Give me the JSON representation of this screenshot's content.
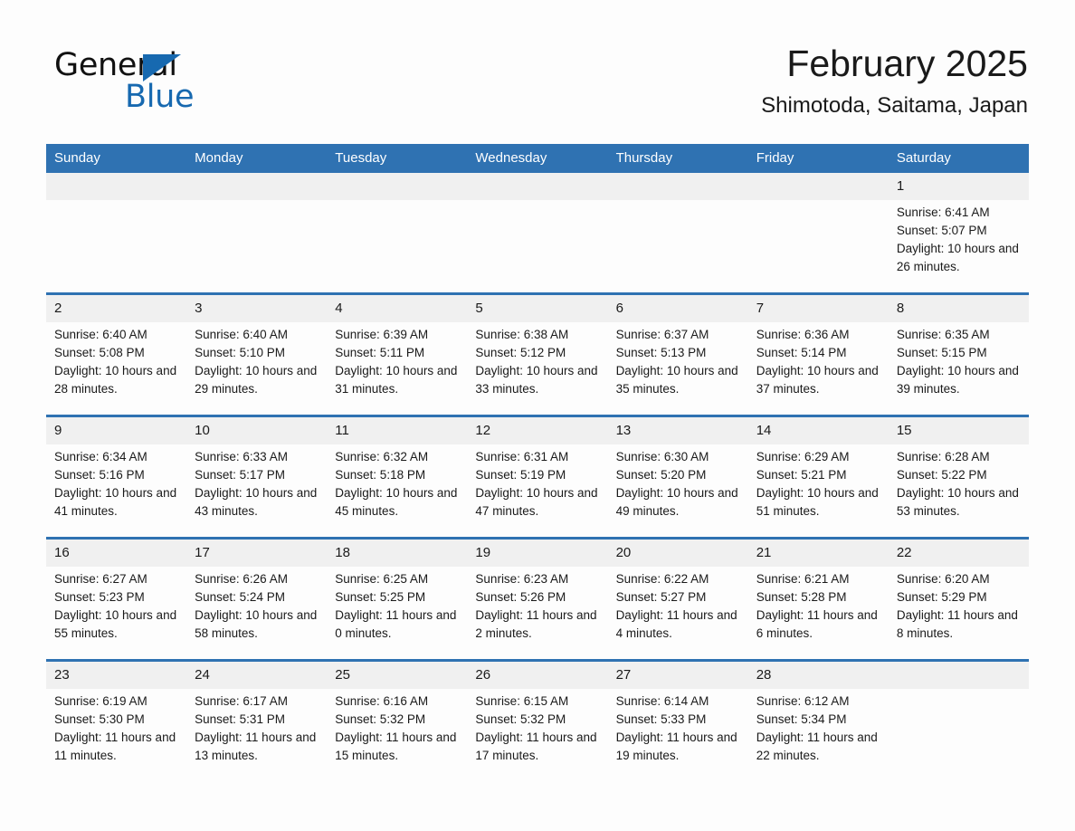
{
  "brand": {
    "name_top": "General",
    "name_bottom": "Blue",
    "triangle_color": "#1769b0",
    "text_color": "#111111"
  },
  "header": {
    "title": "February 2025",
    "subtitle": "Shimotoda, Saitama, Japan"
  },
  "theme": {
    "header_blue": "#2f72b2",
    "row_divider_blue": "#2f72b2",
    "daynum_band": "#f0f0f0",
    "page_bg": "#fdfdfd",
    "text": "#1a1a1a"
  },
  "calendar": {
    "weekday_headers": [
      "Sunday",
      "Monday",
      "Tuesday",
      "Wednesday",
      "Thursday",
      "Friday",
      "Saturday"
    ],
    "labels": {
      "sunrise": "Sunrise:",
      "sunset": "Sunset:",
      "daylight": "Daylight:"
    },
    "weeks": [
      [
        {
          "day": ""
        },
        {
          "day": ""
        },
        {
          "day": ""
        },
        {
          "day": ""
        },
        {
          "day": ""
        },
        {
          "day": ""
        },
        {
          "day": "1",
          "sunrise": "Sunrise: 6:41 AM",
          "sunset": "Sunset: 5:07 PM",
          "daylight": "Daylight: 10 hours and 26 minutes."
        }
      ],
      [
        {
          "day": "2",
          "sunrise": "Sunrise: 6:40 AM",
          "sunset": "Sunset: 5:08 PM",
          "daylight": "Daylight: 10 hours and 28 minutes."
        },
        {
          "day": "3",
          "sunrise": "Sunrise: 6:40 AM",
          "sunset": "Sunset: 5:10 PM",
          "daylight": "Daylight: 10 hours and 29 minutes."
        },
        {
          "day": "4",
          "sunrise": "Sunrise: 6:39 AM",
          "sunset": "Sunset: 5:11 PM",
          "daylight": "Daylight: 10 hours and 31 minutes."
        },
        {
          "day": "5",
          "sunrise": "Sunrise: 6:38 AM",
          "sunset": "Sunset: 5:12 PM",
          "daylight": "Daylight: 10 hours and 33 minutes."
        },
        {
          "day": "6",
          "sunrise": "Sunrise: 6:37 AM",
          "sunset": "Sunset: 5:13 PM",
          "daylight": "Daylight: 10 hours and 35 minutes."
        },
        {
          "day": "7",
          "sunrise": "Sunrise: 6:36 AM",
          "sunset": "Sunset: 5:14 PM",
          "daylight": "Daylight: 10 hours and 37 minutes."
        },
        {
          "day": "8",
          "sunrise": "Sunrise: 6:35 AM",
          "sunset": "Sunset: 5:15 PM",
          "daylight": "Daylight: 10 hours and 39 minutes."
        }
      ],
      [
        {
          "day": "9",
          "sunrise": "Sunrise: 6:34 AM",
          "sunset": "Sunset: 5:16 PM",
          "daylight": "Daylight: 10 hours and 41 minutes."
        },
        {
          "day": "10",
          "sunrise": "Sunrise: 6:33 AM",
          "sunset": "Sunset: 5:17 PM",
          "daylight": "Daylight: 10 hours and 43 minutes."
        },
        {
          "day": "11",
          "sunrise": "Sunrise: 6:32 AM",
          "sunset": "Sunset: 5:18 PM",
          "daylight": "Daylight: 10 hours and 45 minutes."
        },
        {
          "day": "12",
          "sunrise": "Sunrise: 6:31 AM",
          "sunset": "Sunset: 5:19 PM",
          "daylight": "Daylight: 10 hours and 47 minutes."
        },
        {
          "day": "13",
          "sunrise": "Sunrise: 6:30 AM",
          "sunset": "Sunset: 5:20 PM",
          "daylight": "Daylight: 10 hours and 49 minutes."
        },
        {
          "day": "14",
          "sunrise": "Sunrise: 6:29 AM",
          "sunset": "Sunset: 5:21 PM",
          "daylight": "Daylight: 10 hours and 51 minutes."
        },
        {
          "day": "15",
          "sunrise": "Sunrise: 6:28 AM",
          "sunset": "Sunset: 5:22 PM",
          "daylight": "Daylight: 10 hours and 53 minutes."
        }
      ],
      [
        {
          "day": "16",
          "sunrise": "Sunrise: 6:27 AM",
          "sunset": "Sunset: 5:23 PM",
          "daylight": "Daylight: 10 hours and 55 minutes."
        },
        {
          "day": "17",
          "sunrise": "Sunrise: 6:26 AM",
          "sunset": "Sunset: 5:24 PM",
          "daylight": "Daylight: 10 hours and 58 minutes."
        },
        {
          "day": "18",
          "sunrise": "Sunrise: 6:25 AM",
          "sunset": "Sunset: 5:25 PM",
          "daylight": "Daylight: 11 hours and 0 minutes."
        },
        {
          "day": "19",
          "sunrise": "Sunrise: 6:23 AM",
          "sunset": "Sunset: 5:26 PM",
          "daylight": "Daylight: 11 hours and 2 minutes."
        },
        {
          "day": "20",
          "sunrise": "Sunrise: 6:22 AM",
          "sunset": "Sunset: 5:27 PM",
          "daylight": "Daylight: 11 hours and 4 minutes."
        },
        {
          "day": "21",
          "sunrise": "Sunrise: 6:21 AM",
          "sunset": "Sunset: 5:28 PM",
          "daylight": "Daylight: 11 hours and 6 minutes."
        },
        {
          "day": "22",
          "sunrise": "Sunrise: 6:20 AM",
          "sunset": "Sunset: 5:29 PM",
          "daylight": "Daylight: 11 hours and 8 minutes."
        }
      ],
      [
        {
          "day": "23",
          "sunrise": "Sunrise: 6:19 AM",
          "sunset": "Sunset: 5:30 PM",
          "daylight": "Daylight: 11 hours and 11 minutes."
        },
        {
          "day": "24",
          "sunrise": "Sunrise: 6:17 AM",
          "sunset": "Sunset: 5:31 PM",
          "daylight": "Daylight: 11 hours and 13 minutes."
        },
        {
          "day": "25",
          "sunrise": "Sunrise: 6:16 AM",
          "sunset": "Sunset: 5:32 PM",
          "daylight": "Daylight: 11 hours and 15 minutes."
        },
        {
          "day": "26",
          "sunrise": "Sunrise: 6:15 AM",
          "sunset": "Sunset: 5:32 PM",
          "daylight": "Daylight: 11 hours and 17 minutes."
        },
        {
          "day": "27",
          "sunrise": "Sunrise: 6:14 AM",
          "sunset": "Sunset: 5:33 PM",
          "daylight": "Daylight: 11 hours and 19 minutes."
        },
        {
          "day": "28",
          "sunrise": "Sunrise: 6:12 AM",
          "sunset": "Sunset: 5:34 PM",
          "daylight": "Daylight: 11 hours and 22 minutes."
        },
        {
          "day": ""
        }
      ]
    ]
  }
}
